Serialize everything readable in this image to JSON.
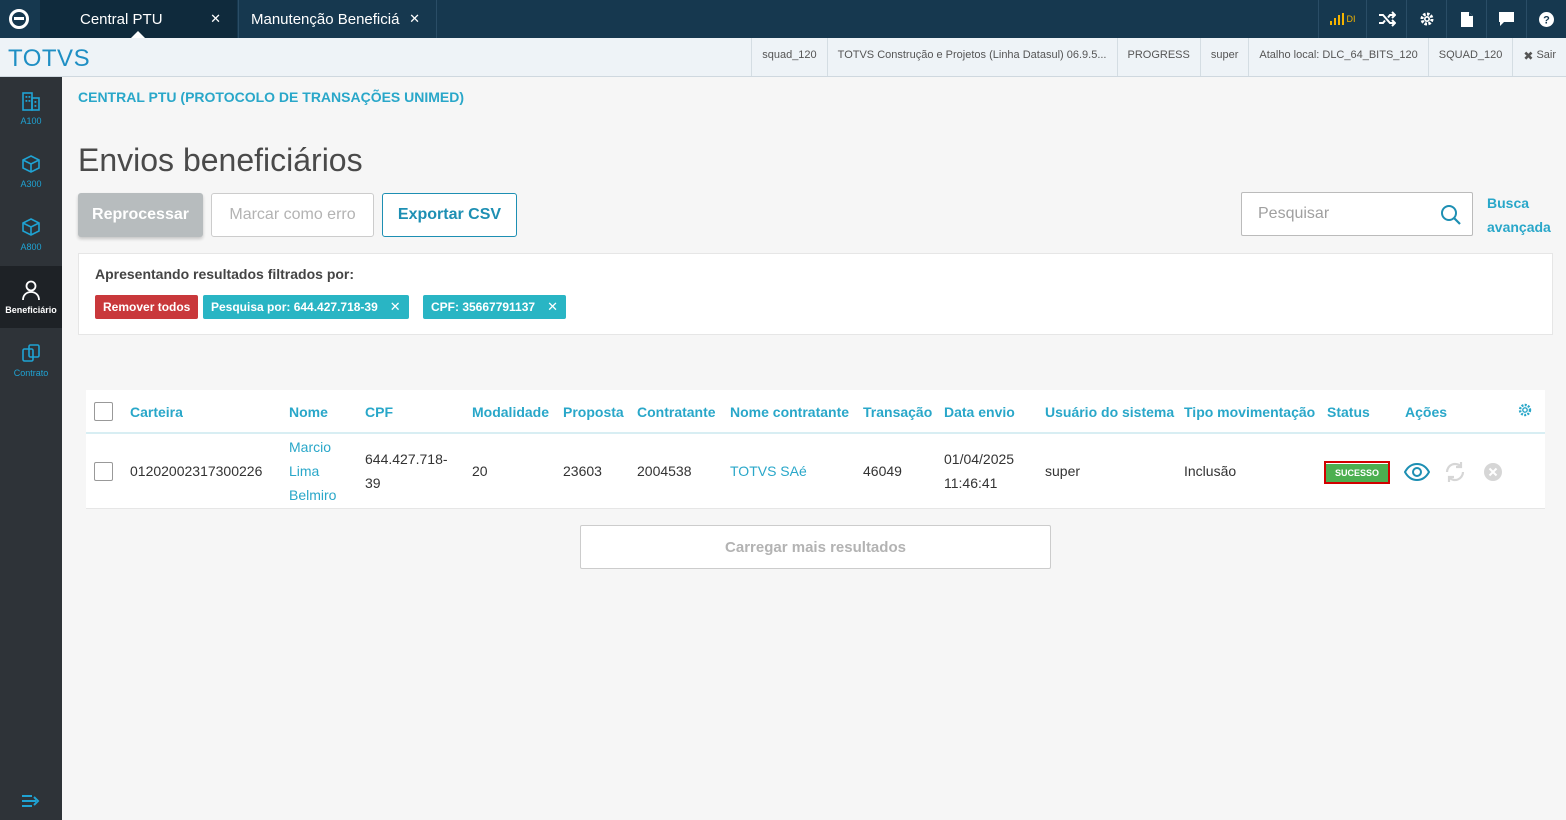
{
  "tabs": [
    {
      "label": "Central PTU",
      "active": true
    },
    {
      "label": "Manutenção Beneficiá",
      "active": false
    }
  ],
  "topbar": {
    "signal_label": "DI",
    "icons": [
      "shuffle-icon",
      "gear-icon",
      "document-icon",
      "chat-icon",
      "help-icon"
    ]
  },
  "header": {
    "brand": "TOTVS",
    "info": [
      "squad_120",
      "TOTVS Construção e Projetos (Linha Datasul) 06.9.5...",
      "PROGRESS",
      "super",
      "Atalho local: DLC_64_BITS_120",
      "SQUAD_120"
    ],
    "exit_label": "Sair"
  },
  "sidebar": {
    "items": [
      {
        "label": "A100",
        "icon": "building-icon"
      },
      {
        "label": "A300",
        "icon": "box-icon"
      },
      {
        "label": "A800",
        "icon": "box-icon"
      },
      {
        "label": "Beneficiário",
        "icon": "person-icon",
        "active": true
      },
      {
        "label": "Contrato",
        "icon": "copy-icon"
      }
    ]
  },
  "main": {
    "breadcrumb": "CENTRAL PTU (PROTOCOLO DE TRANSAÇÕES UNIMED)",
    "title": "Envios beneficiários",
    "buttons": {
      "reprocess": "Reprocessar",
      "mark_error": "Marcar como erro",
      "export_csv": "Exportar CSV"
    },
    "search": {
      "placeholder": "Pesquisar",
      "value": ""
    },
    "advanced_search": "Busca avançada",
    "filters": {
      "title": "Apresentando resultados filtrados por:",
      "remove_all": "Remover todos",
      "chips": [
        "Pesquisa por: 644.427.718-39",
        "CPF: 35667791137"
      ]
    },
    "table": {
      "headers": [
        "Carteira",
        "Nome",
        "CPF",
        "Modalidade",
        "Proposta",
        "Contratante",
        "Nome contratante",
        "Transação",
        "Data envio",
        "Usuário do sistema",
        "Tipo movimentação",
        "Status",
        "Ações"
      ],
      "rows": [
        {
          "carteira": "01202002317300226",
          "nome_l1": "Marcio",
          "nome_l2": "Lima",
          "nome_l3": "Belmiro",
          "cpf_l1": "644.427.718-",
          "cpf_l2": "39",
          "modalidade": "20",
          "proposta": "23603",
          "contratante": "2004538",
          "nome_contratante": "TOTVS SAé",
          "transacao": "46049",
          "data_l1": "01/04/2025",
          "data_l2": "11:46:41",
          "usuario": "super",
          "tipo": "Inclusão",
          "status": "SUCESSO"
        }
      ]
    },
    "load_more": "Carregar mais resultados"
  },
  "colors": {
    "topbar": "#16384f",
    "accent": "#29a7c9",
    "danger": "#c9383b",
    "chip": "#29b5c4",
    "success": "#4caf50"
  }
}
